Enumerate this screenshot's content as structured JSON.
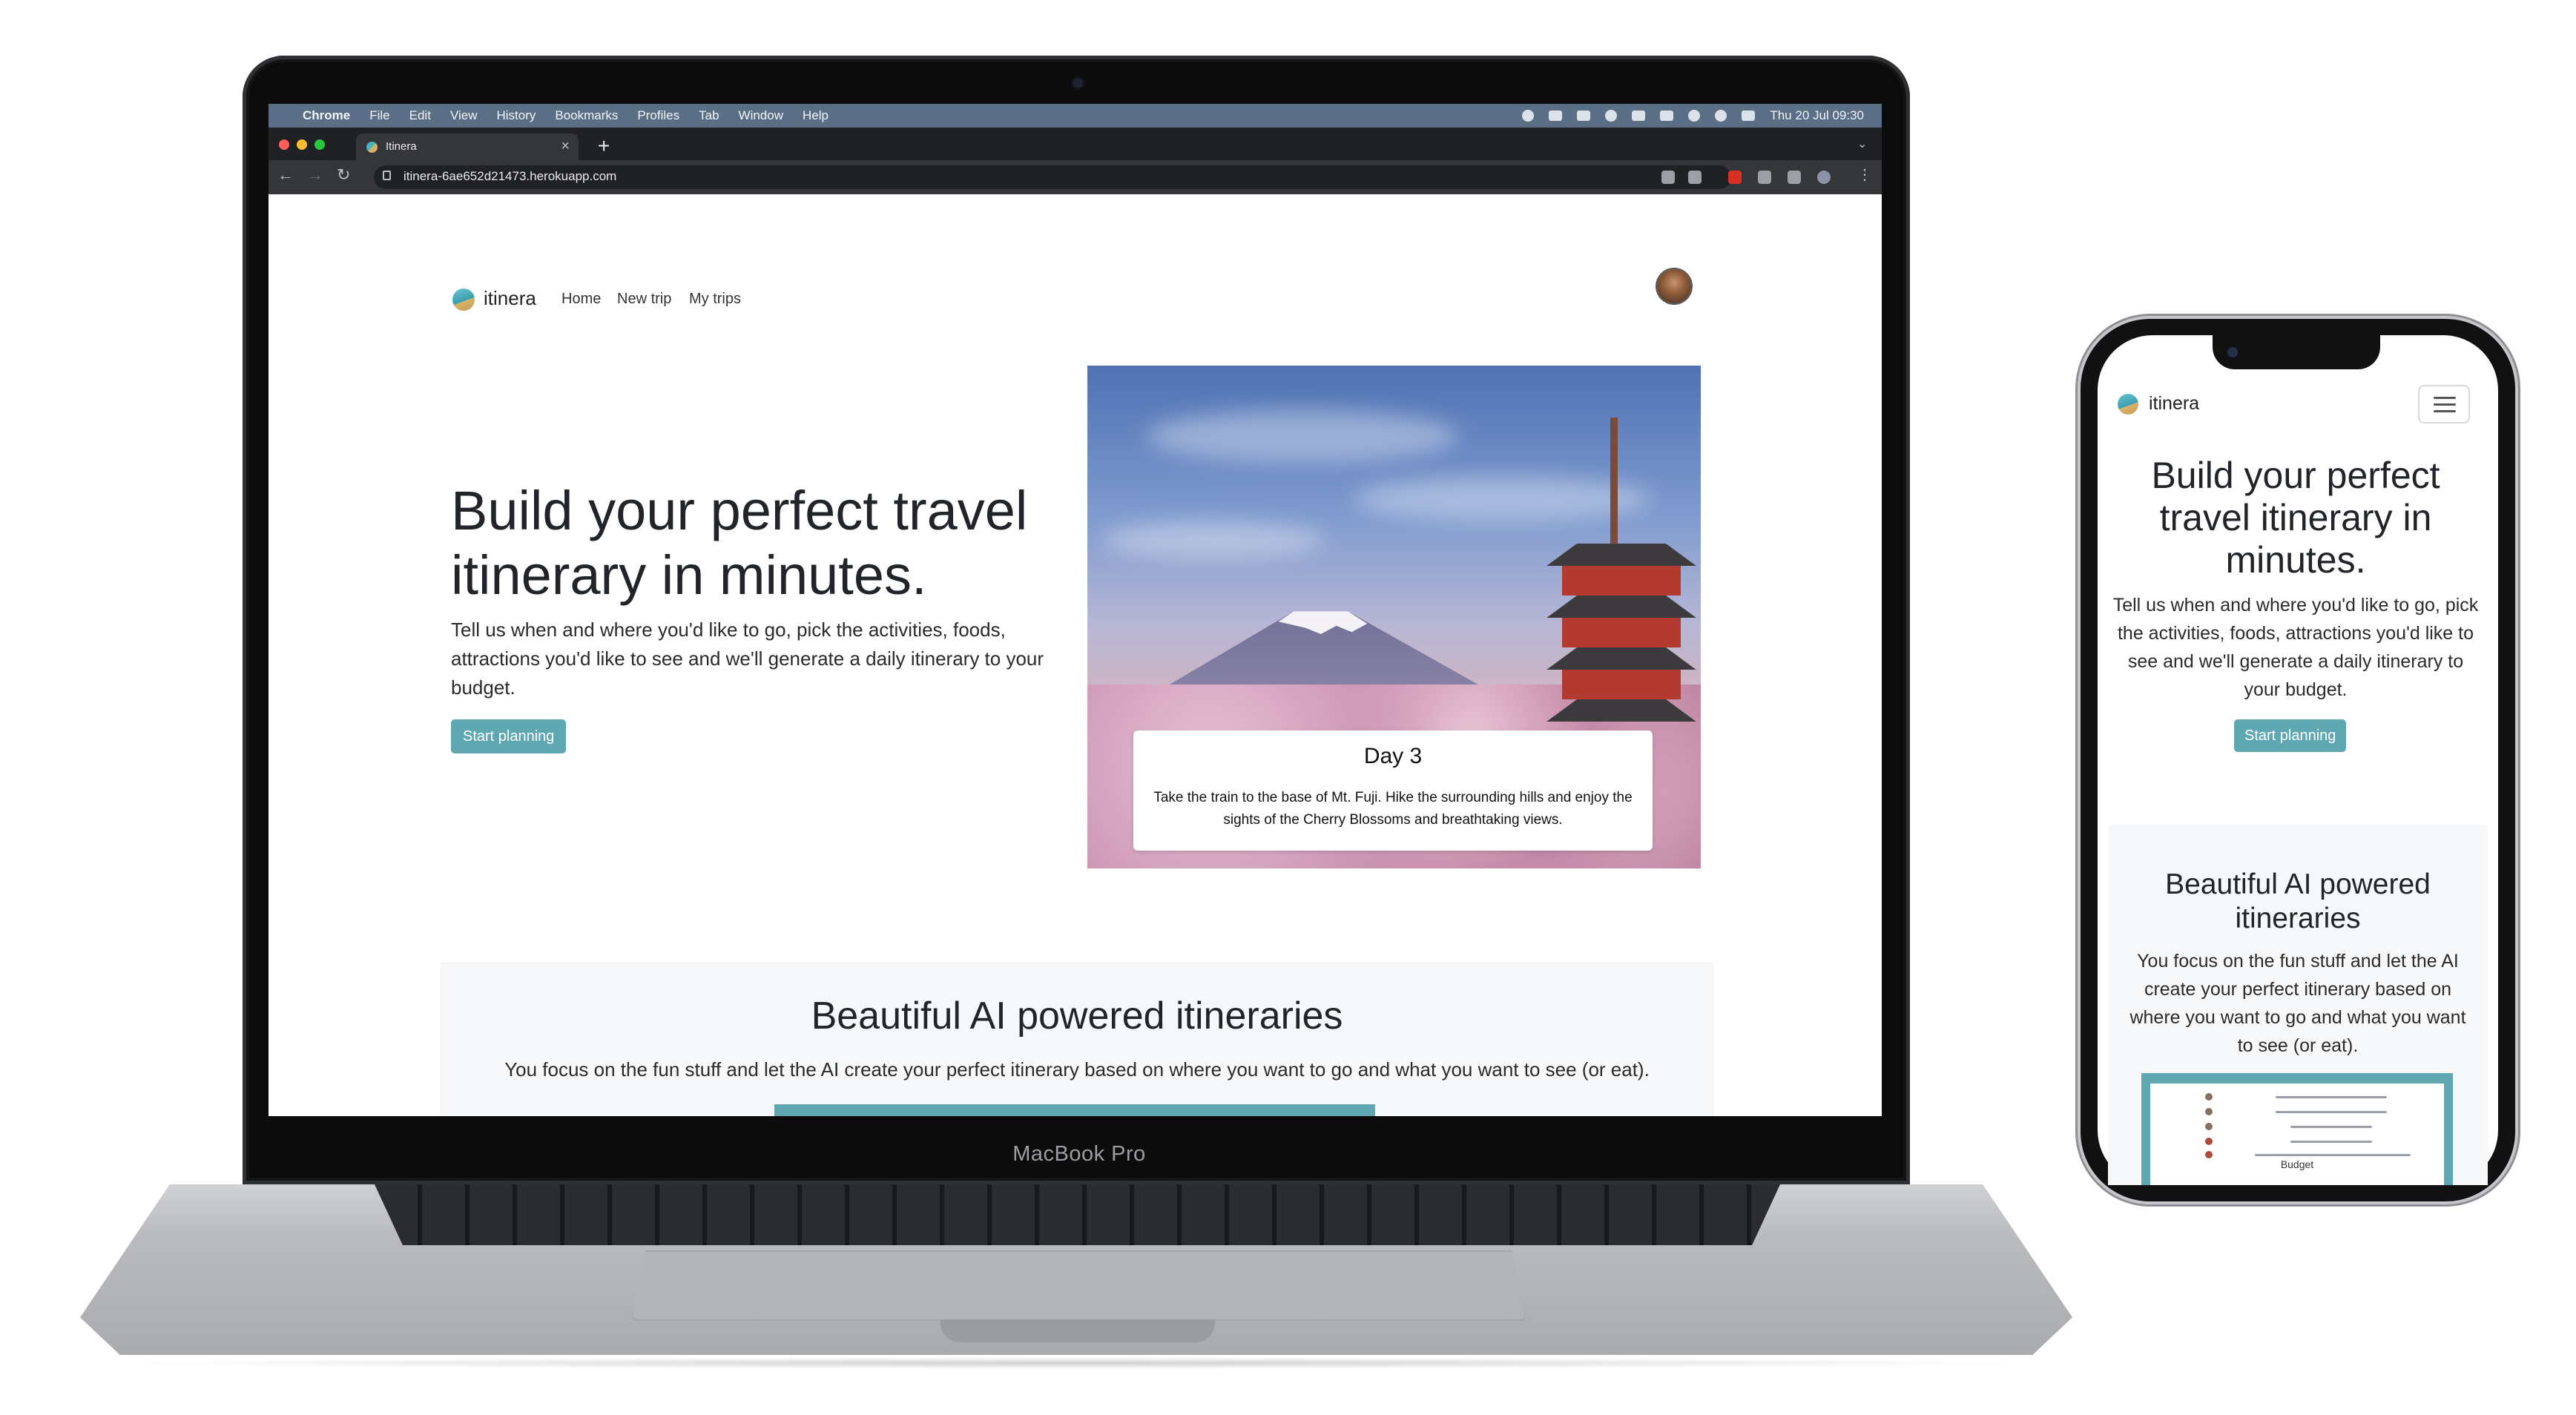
{
  "laptop": {
    "brand": "MacBook Pro",
    "menubar": {
      "apple_icon": "",
      "items": [
        "Chrome",
        "File",
        "Edit",
        "View",
        "History",
        "Bookmarks",
        "Profiles",
        "Tab",
        "Window",
        "Help"
      ],
      "datetime": "Thu 20 Jul 09:30"
    },
    "browser": {
      "tab_title": "Itinera",
      "tab_close": "×",
      "new_tab": "+",
      "url": "itinera-6ae652d21473.herokuapp.com",
      "back_icon": "←",
      "forward_icon": "→",
      "reload_icon": "↻",
      "menu_icon": "⋮"
    },
    "site": {
      "logo_text": "itinera",
      "nav": [
        "Home",
        "New trip",
        "My trips"
      ],
      "hero_title": "Build your perfect travel itinerary in minutes.",
      "hero_subtitle": "Tell us when and where you'd like to go, pick the activities, foods, attractions you'd like to see and we'll generate a daily itinerary to your budget.",
      "cta": "Start planning",
      "card": {
        "title": "Day 3",
        "text": "Take the train to the base of Mt. Fuji. Hike the surrounding hills and enjoy the sights of the Cherry Blossoms and breathtaking views."
      },
      "feature_title": "Beautiful AI powered itineraries",
      "feature_subtitle": "You focus on the fun stuff and let the AI create your perfect itinerary based on where you want to go and what you want to see (or eat)."
    }
  },
  "phone": {
    "logo_text": "itinera",
    "menu_icon": "hamburger-icon",
    "hero_title": "Build your perfect travel itinerary in minutes.",
    "hero_subtitle": "Tell us when and where you'd like to go, pick the activities, foods, attractions you'd like to see and we'll generate a daily itinerary to your budget.",
    "cta": "Start planning",
    "feature_title": "Beautiful AI powered itineraries",
    "feature_subtitle": "You focus on the fun stuff and let the AI create your perfect itinerary based on where you want to go and what you want to see (or eat).",
    "preview_budget": "Budget"
  },
  "colors": {
    "accent": "#5fa7b1",
    "menubar": "#5a6f86",
    "browser_dark": "#202124",
    "browser_mid": "#35363a",
    "feature_bg": "#f6f8fa"
  }
}
